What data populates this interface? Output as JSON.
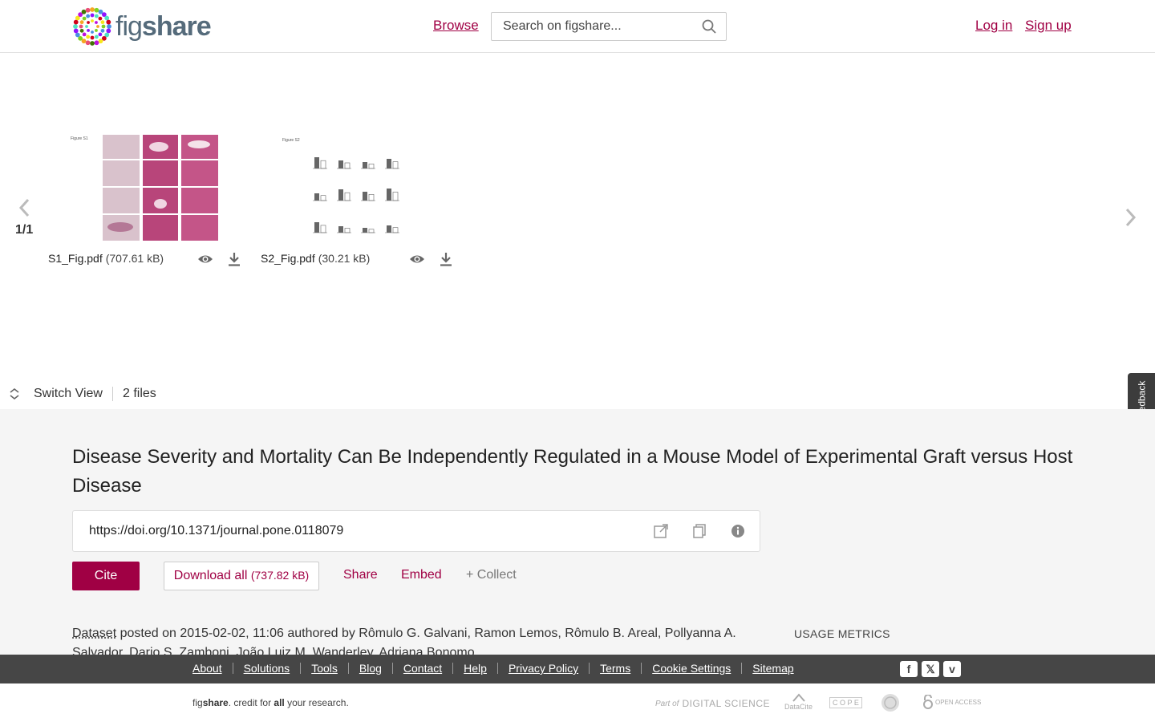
{
  "header": {
    "logo_text_fig": "fig",
    "logo_text_share": "share",
    "browse_label": "Browse",
    "search_placeholder": "Search on figshare...",
    "login_label": "Log in",
    "signup_label": "Sign up"
  },
  "preview": {
    "counter": "1/1",
    "thumb1_caption": "Figure S1",
    "thumb2_caption": "Figure S2",
    "files": [
      {
        "name": "S1_Fig.pdf",
        "size": "(707.61 kB)"
      },
      {
        "name": "S2_Fig.pdf",
        "size": "(30.21 kB)"
      }
    ],
    "switch_view_label": "Switch View",
    "file_count": "2 files",
    "feedback_label": "Give Feedback"
  },
  "details": {
    "title": "Disease Severity and Mortality Can Be Independently Regulated in a Mouse Model of Experimental Graft versus Host Disease",
    "doi": "https://doi.org/10.1371/journal.pone.0118079",
    "cite_label": "Cite",
    "download_label": "Download all",
    "download_size": "(737.82 kB)",
    "share_label": "Share",
    "embed_label": "Embed",
    "collect_label": "+ Collect",
    "dataset_label": "Dataset",
    "posted_text": " posted on 2015-02-02, 11:06 authored by Rômulo G. Galvani, Ramon Lemos, Rômulo B. Areal, Pollyanna A. Salvador, Dario S. Zamboni, João Luiz M. Wanderley, Adriana Bonomo",
    "usage_metrics_label": "USAGE METRICS"
  },
  "footer": {
    "links": [
      "About",
      "Solutions",
      "Tools",
      "Blog",
      "Contact",
      "Help",
      "Privacy Policy",
      "Terms",
      "Cookie Settings",
      "Sitemap"
    ],
    "tagline_fig": "fig",
    "tagline_share": "share",
    "tagline_mid": ". credit for ",
    "tagline_all": "all",
    "tagline_end": " your research.",
    "partner_digital_science_prefix": "Part of",
    "partner_digital_science": "DIGITAL SCIENCE",
    "partner_datacite": "DataCite",
    "partner_cope": "C O P E",
    "partner_open_access": "OPEN ACCESS"
  },
  "colors": {
    "accent": "#a00044",
    "footer_bg": "#464646",
    "details_bg": "#f5f5f5"
  }
}
